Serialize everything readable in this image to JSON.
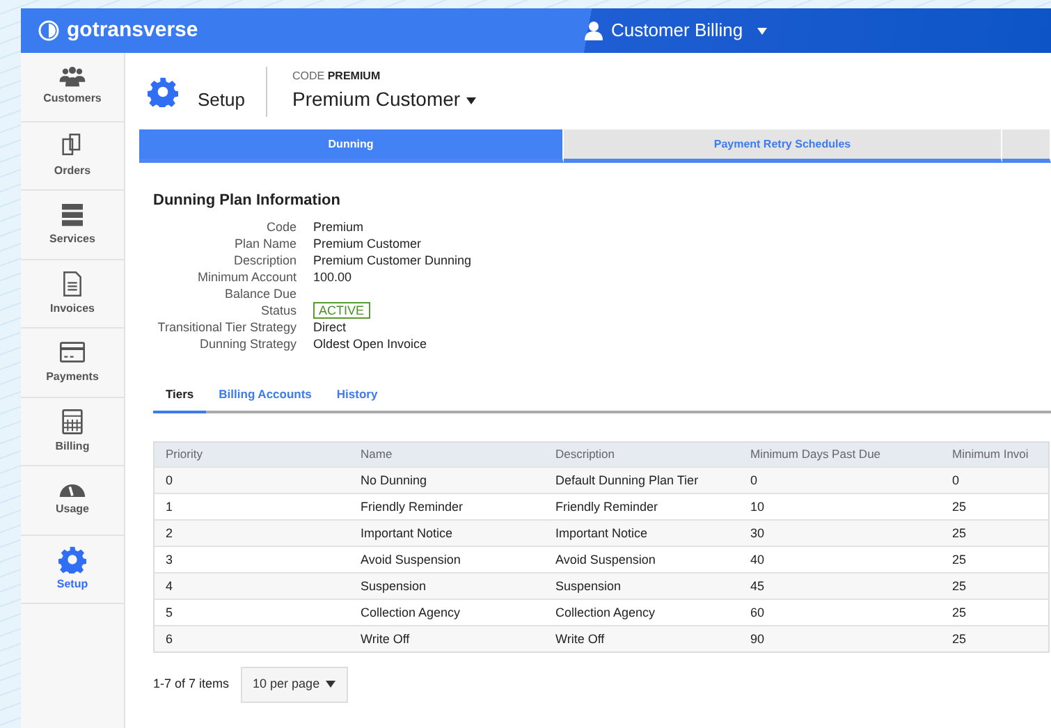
{
  "header": {
    "brand": "gotransverse",
    "user_menu": "Customer Billing"
  },
  "sidebar": {
    "items": [
      {
        "label": "Customers",
        "selected": false
      },
      {
        "label": "Orders",
        "selected": false
      },
      {
        "label": "Services",
        "selected": false
      },
      {
        "label": "Invoices",
        "selected": false
      },
      {
        "label": "Payments",
        "selected": false
      },
      {
        "label": "Billing",
        "selected": false
      },
      {
        "label": "Usage",
        "selected": false
      },
      {
        "label": "Setup",
        "selected": true
      }
    ]
  },
  "page": {
    "section": "Setup",
    "code_label": "CODE",
    "code": "PREMIUM",
    "plan_menu": "Premium Customer"
  },
  "tabs": [
    {
      "label": "Dunning",
      "selected": true
    },
    {
      "label": "Payment Retry Schedules",
      "selected": false
    },
    {
      "selected": false
    }
  ],
  "info": {
    "title": "Dunning Plan Information",
    "fields": [
      {
        "label": "Code",
        "value": "Premium",
        "kind": "text"
      },
      {
        "label": "Plan Name",
        "value": "Premium Customer",
        "kind": "text"
      },
      {
        "label": "Description",
        "value": "Premium Customer Dunning",
        "kind": "text"
      },
      {
        "label": "Minimum Account Balance Due",
        "value": "100.00",
        "kind": "text"
      },
      {
        "label": "Status",
        "value": "ACTIVE",
        "kind": "status"
      },
      {
        "label": "Transitional Tier Strategy",
        "value": "Direct",
        "kind": "text"
      },
      {
        "label": "Dunning Strategy",
        "value": "Oldest Open Invoice",
        "kind": "text"
      }
    ]
  },
  "subtabs": [
    {
      "label": "Tiers",
      "selected": true
    },
    {
      "label": "Billing Accounts",
      "selected": false
    },
    {
      "label": "History",
      "selected": false
    }
  ],
  "table": {
    "columns": [
      "Priority",
      "Name",
      "Description",
      "Minimum Days Past Due",
      "Minimum Invoi"
    ],
    "rows": [
      [
        "0",
        "No Dunning",
        "Default Dunning Plan Tier",
        "0",
        "0"
      ],
      [
        "1",
        "Friendly Reminder",
        "Friendly Reminder",
        "10",
        "25"
      ],
      [
        "2",
        "Important Notice",
        "Important Notice",
        "30",
        "25"
      ],
      [
        "3",
        "Avoid Suspension",
        "Avoid Suspension",
        "40",
        "25"
      ],
      [
        "4",
        "Suspension",
        "Suspension",
        "45",
        "25"
      ],
      [
        "5",
        "Collection Agency",
        "Collection Agency",
        "60",
        "25"
      ],
      [
        "6",
        "Write Off",
        "Write Off",
        "90",
        "25"
      ]
    ]
  },
  "pagination": {
    "summary": "1-7 of 7 items",
    "page_size": "10 per page"
  }
}
